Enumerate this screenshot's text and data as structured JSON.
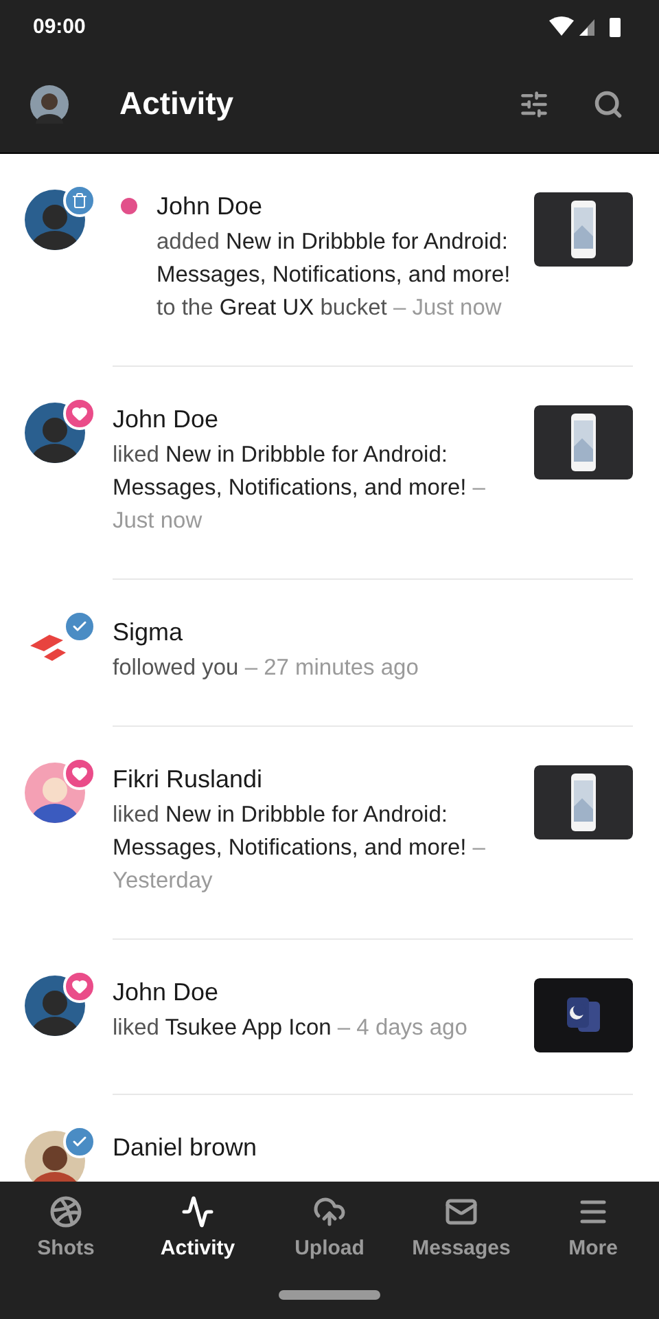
{
  "status_bar": {
    "time": "09:00"
  },
  "app_bar": {
    "title": "Activity"
  },
  "activities": [
    {
      "kind": "added",
      "unread": true,
      "name": "John Doe",
      "text": "added **New in Dribbble for Android: Messages, Notifications, and more!** to the **Great UX** bucket",
      "time": "– Just now"
    },
    {
      "kind": "liked",
      "unread": false,
      "name": "John Doe",
      "text": "liked **New in Dribbble for Android: Messages, Notifications, and more!**",
      "time": "– Just now"
    },
    {
      "kind": "followed",
      "unread": false,
      "name": "Sigma",
      "text": "followed you",
      "time": "– 27 minutes ago"
    },
    {
      "kind": "liked",
      "unread": false,
      "name": "Fikri Ruslandi",
      "text": "liked **New in Dribbble for Android: Messages, Notifications, and more!**",
      "time": "– Yesterday"
    },
    {
      "kind": "liked",
      "unread": false,
      "name": "John Doe",
      "text": "liked **Tsukee App Icon**",
      "time": "– 4 days ago"
    },
    {
      "kind": "followed",
      "unread": false,
      "name": "Daniel brown"
    }
  ],
  "nav": [
    {
      "label": "Shots",
      "selected": false
    },
    {
      "label": "Activity",
      "selected": true
    },
    {
      "label": "Upload",
      "selected": false
    },
    {
      "label": "Messages",
      "selected": false
    },
    {
      "label": "More",
      "selected": false
    }
  ]
}
